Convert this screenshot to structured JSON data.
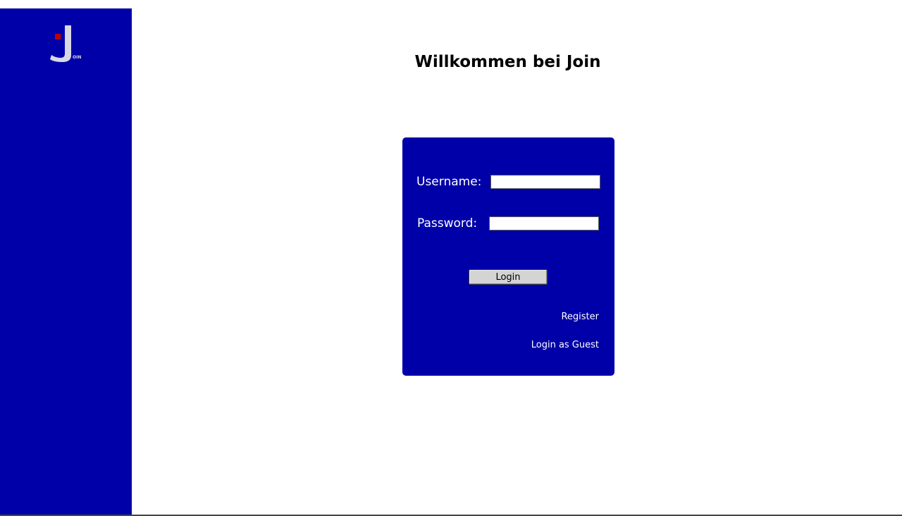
{
  "brand": {
    "logo_text": "OIN",
    "colors": {
      "sidebar": "#0000a8",
      "accent": "#c00000",
      "logo_letter": "#d8d8e8"
    }
  },
  "page": {
    "title": "Willkommen bei Join"
  },
  "login": {
    "username_label": "Username:",
    "username_value": "",
    "password_label": "Password:",
    "password_value": "",
    "login_button": "Login",
    "register_link": "Register",
    "guest_link": "Login as Guest"
  }
}
